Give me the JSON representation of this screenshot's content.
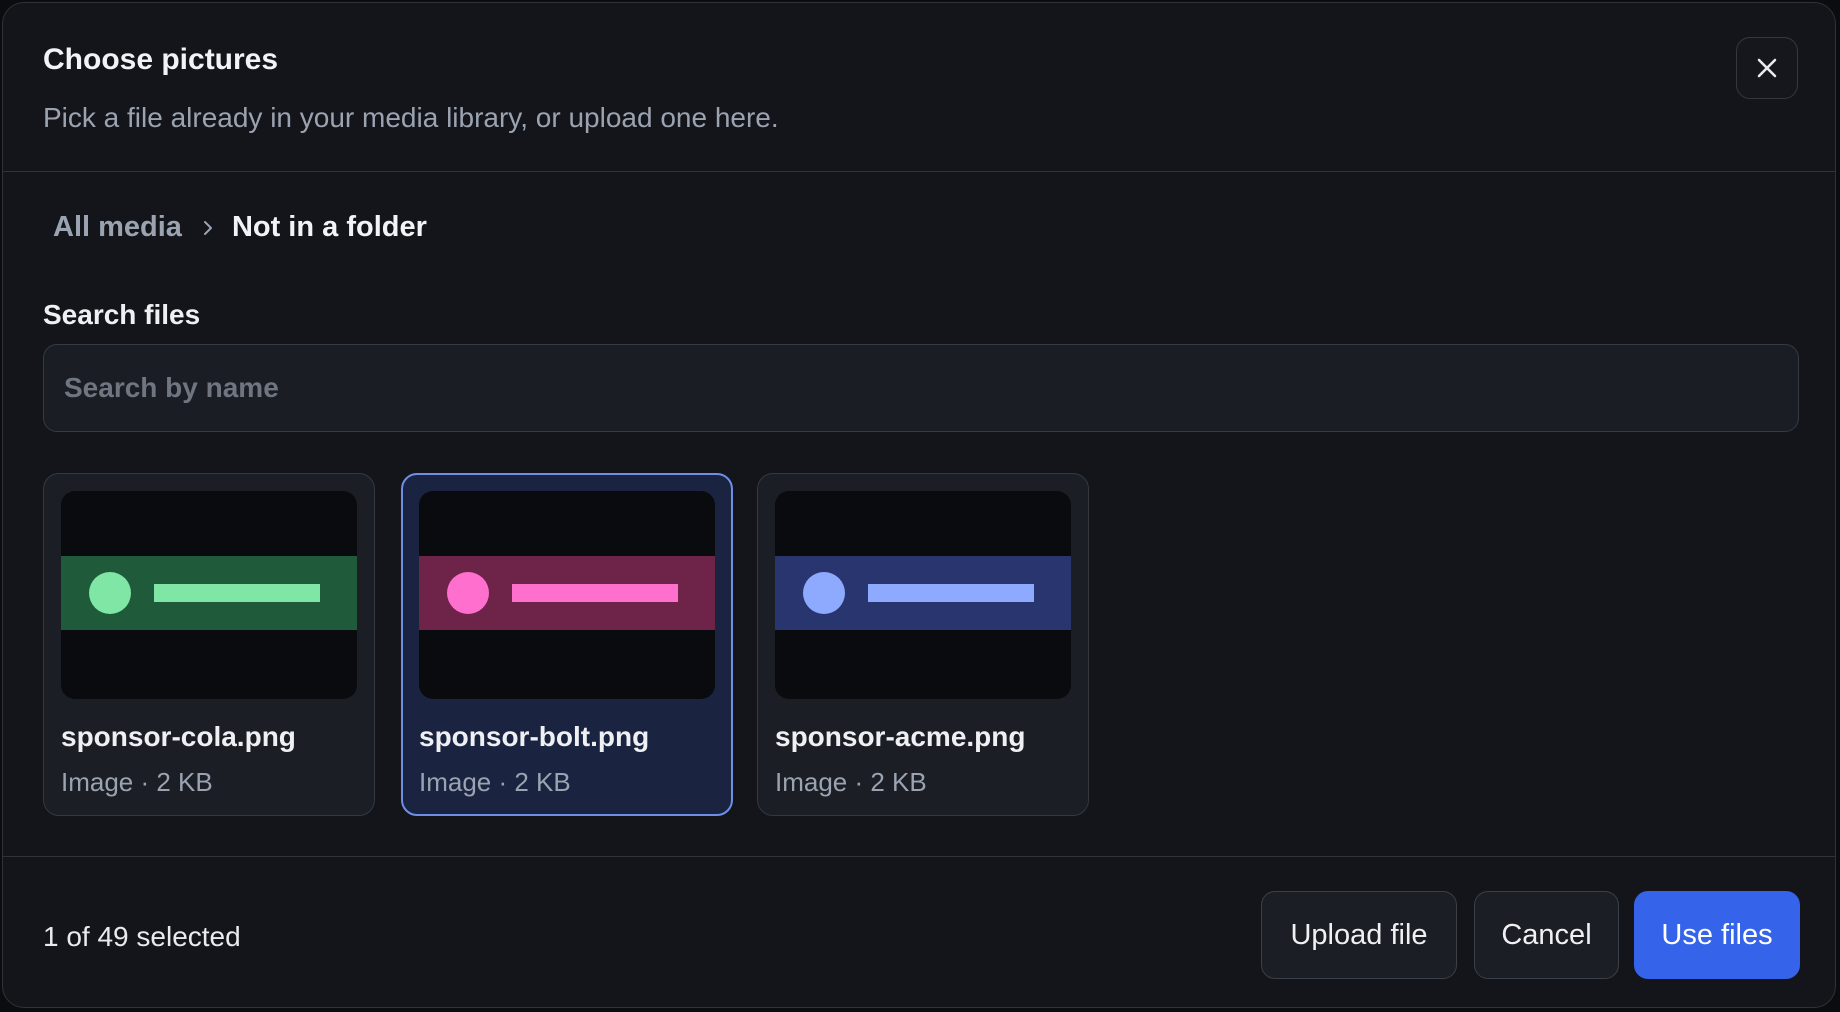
{
  "dialog": {
    "title": "Choose pictures",
    "subtitle": "Pick a file already in your media library, or upload one here.",
    "close_icon": "close-icon"
  },
  "breadcrumb": {
    "root": "All media",
    "separator_icon": "chevron-right-icon",
    "current": "Not in a folder"
  },
  "search": {
    "label": "Search files",
    "placeholder": "Search by name",
    "value": ""
  },
  "files": [
    {
      "name": "sponsor-cola.png",
      "meta": "Image · 2 KB",
      "selected": false,
      "colors": {
        "band": "#1f5a3a",
        "accent": "#7fe6a5"
      }
    },
    {
      "name": "sponsor-bolt.png",
      "meta": "Image · 2 KB",
      "selected": true,
      "colors": {
        "band": "#6e2348",
        "accent": "#ff6fce"
      }
    },
    {
      "name": "sponsor-acme.png",
      "meta": "Image · 2 KB",
      "selected": false,
      "colors": {
        "band": "#28356f",
        "accent": "#8eaaff"
      }
    }
  ],
  "footer": {
    "selection_status": "1 of 49 selected",
    "upload_label": "Upload file",
    "cancel_label": "Cancel",
    "confirm_label": "Use files"
  },
  "colors": {
    "primary": "#3563e9",
    "selected_border": "#6f8fe6",
    "background": "#13151a"
  }
}
